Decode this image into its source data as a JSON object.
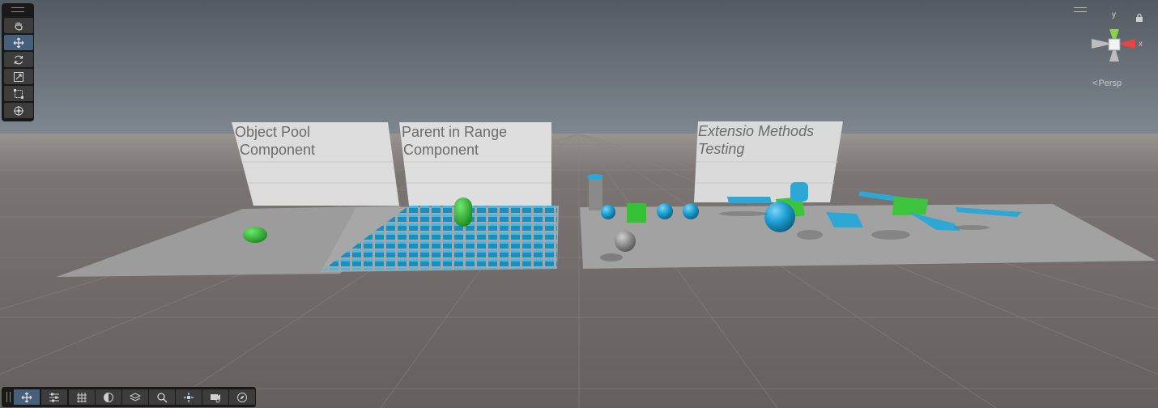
{
  "scene": {
    "labels": [
      {
        "line1": "Object Pool",
        "line2": "Component"
      },
      {
        "line1": "Parent in Range",
        "line2": "Component"
      },
      {
        "line1": "Extensio Methods",
        "line2": "Testing"
      }
    ]
  },
  "tools": [
    {
      "name": "hand-tool",
      "icon": "hand-icon",
      "active": false
    },
    {
      "name": "move-tool",
      "icon": "move-icon",
      "active": true
    },
    {
      "name": "rotate-tool",
      "icon": "rotate-icon",
      "active": false
    },
    {
      "name": "scale-tool",
      "icon": "scale-icon",
      "active": false
    },
    {
      "name": "rect-tool",
      "icon": "rect-icon",
      "active": false
    },
    {
      "name": "transform-tool",
      "icon": "transform-icon",
      "active": false
    }
  ],
  "overlay_toolbar": [
    {
      "name": "tool-settings",
      "icon": "move-icon",
      "active": true
    },
    {
      "name": "scene-view-options",
      "icon": "sliders-icon",
      "active": false
    },
    {
      "name": "grid-toggle",
      "icon": "grid-icon",
      "active": false
    },
    {
      "name": "draw-mode",
      "icon": "shading-icon",
      "active": false
    },
    {
      "name": "layers",
      "icon": "layers-icon",
      "active": false
    },
    {
      "name": "search",
      "icon": "search-icon",
      "active": false
    },
    {
      "name": "orientation",
      "icon": "orientation-icon",
      "active": false
    },
    {
      "name": "camera",
      "icon": "camera-icon",
      "active": false
    },
    {
      "name": "navigation",
      "icon": "compass-icon",
      "active": false
    }
  ],
  "gizmo": {
    "projection_label": "Persp",
    "axis_y": "y",
    "axis_x": "x",
    "colors": {
      "x": "#e8453c",
      "y": "#8fd14f",
      "neutral": "#bdbdbd"
    }
  },
  "colors": {
    "accent_blue": "#1d9fd1",
    "object_green": "#2fb52f",
    "ground": "#6a6462",
    "panel": "#191919",
    "button_active": "#46607c"
  }
}
